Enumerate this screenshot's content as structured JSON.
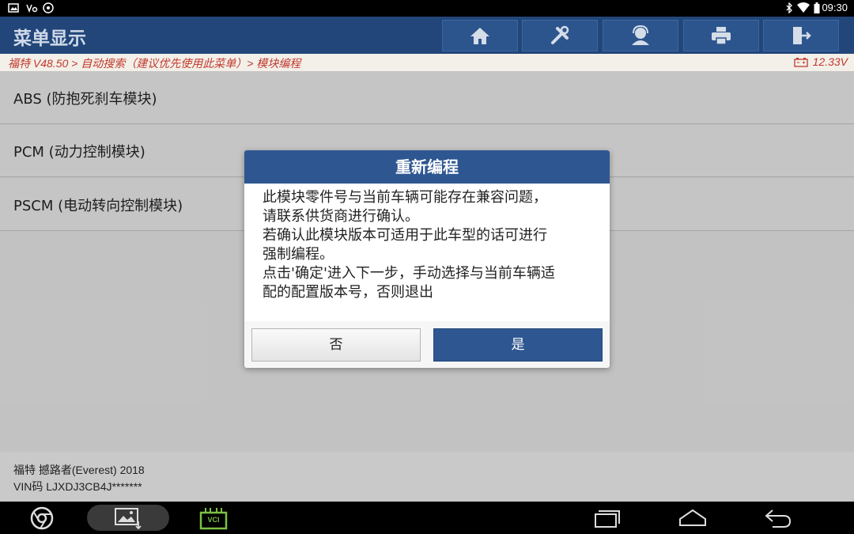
{
  "status_bar": {
    "time": "09:30",
    "left_icons": [
      "image-icon",
      "voicemail-icon",
      "settings-icon"
    ],
    "right_icons": [
      "bluetooth-icon",
      "wifi-icon",
      "battery-icon"
    ]
  },
  "header": {
    "title": "菜单显示",
    "toolbar": [
      "home-icon",
      "tools-icon",
      "support-icon",
      "print-icon",
      "exit-icon"
    ]
  },
  "breadcrumb": {
    "text": "福特 V48.50 > 自动搜索（建议优先使用此菜单）> 模块编程",
    "voltage": "12.33V"
  },
  "menu": {
    "items": [
      {
        "label": "ABS (防抱死刹车模块)"
      },
      {
        "label": "PCM (动力控制模块)"
      },
      {
        "label": "PSCM (电动转向控制模块)"
      }
    ]
  },
  "dialog": {
    "title": "重新编程",
    "lines": [
      "此模块零件号与当前车辆可能存在兼容问题，",
      "请联系供货商进行确认。",
      "若确认此模块版本可适用于此车型的话可进行",
      "强制编程。",
      "点击'确定'进入下一步，手动选择与当前车辆适",
      "配的配置版本号，否则退出"
    ],
    "no_label": "否",
    "yes_label": "是"
  },
  "footer": {
    "vehicle": "福特 撼路者(Everest) 2018",
    "vin": "VIN码 LJXDJ3CB4J*******"
  },
  "nav_bar": {
    "left": [
      "chrome-icon",
      "gallery-icon",
      "vci-icon"
    ],
    "vci_label": "VCI",
    "right": [
      "recent-apps-icon",
      "home-nav-icon",
      "back-icon"
    ]
  },
  "colors": {
    "header": "#22467a",
    "accent": "#2e5791",
    "breadcrumb_text": "#c0392b",
    "vci_green": "#7cc043"
  }
}
